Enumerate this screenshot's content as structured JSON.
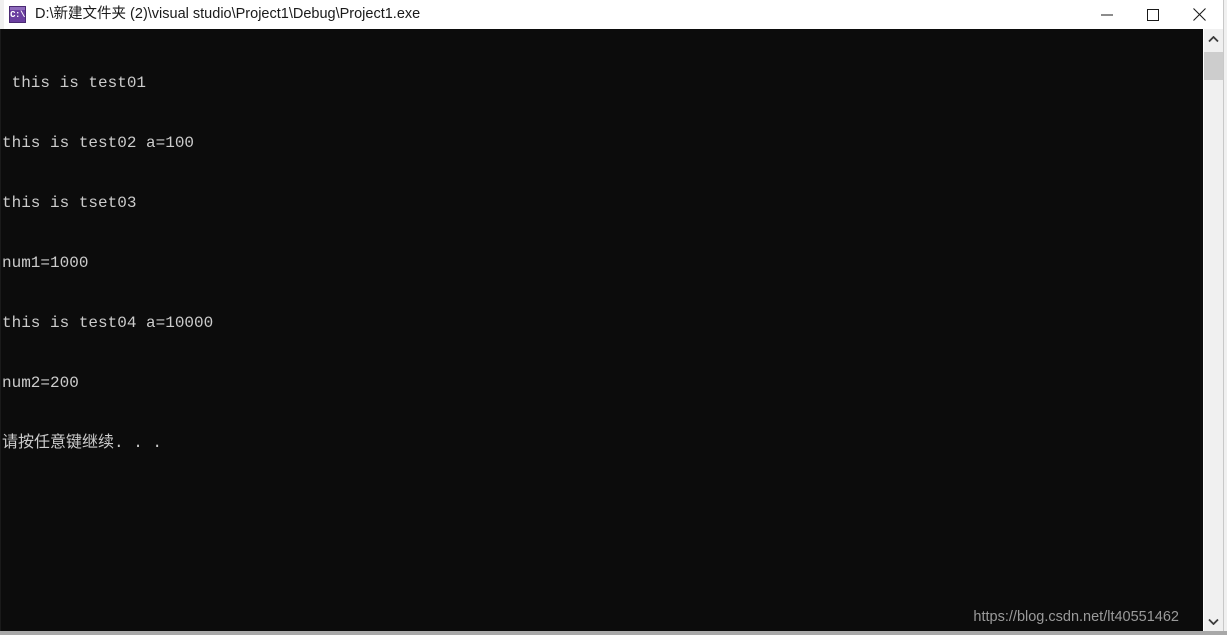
{
  "window": {
    "title": "D:\\新建文件夹 (2)\\visual studio\\Project1\\Debug\\Project1.exe",
    "icon_name": "console-app-icon",
    "icon_glyph": "C:\\",
    "background_color": "#0c0c0c",
    "titlebar_color": "#ffffff",
    "icon_color": "#6b3fa0"
  },
  "controls": {
    "minimize_label": "Minimize",
    "maximize_label": "Maximize",
    "close_label": "Close"
  },
  "console": {
    "text_color": "#cccccc",
    "lines": [
      " this is test01",
      "this is test02 a=100",
      "this is tset03",
      "num1=1000",
      "this is test04 a=10000",
      "num2=200",
      "请按任意键继续. . ."
    ]
  },
  "watermark": {
    "text": "https://blog.csdn.net/lt40551462"
  },
  "scrollbar": {
    "up_arrow_name": "scroll-up-arrow",
    "down_arrow_name": "scroll-down-arrow",
    "thumb_name": "scroll-thumb"
  }
}
